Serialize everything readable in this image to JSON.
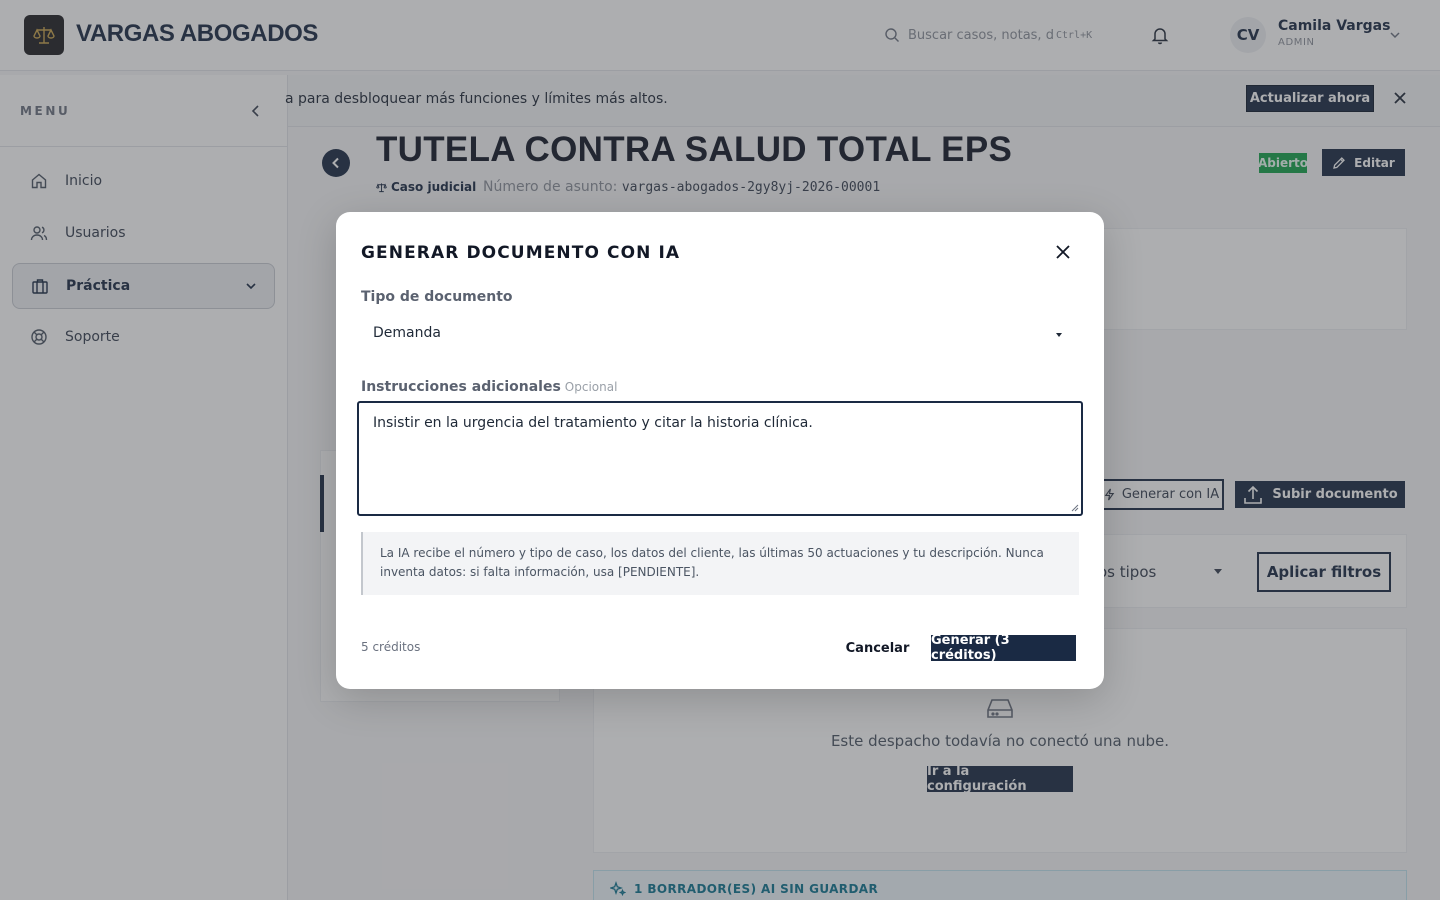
{
  "header": {
    "brand": "VARGAS ABOGADOS",
    "search_placeholder": "Buscar casos, notas, documentos",
    "search_shortcut": "Ctrl+K",
    "user_initials": "CV",
    "user_name": "Camila Vargas",
    "user_role": "ADMIN"
  },
  "sidebar": {
    "title": "MENU",
    "items": [
      {
        "label": "Inicio",
        "icon": "home-icon"
      },
      {
        "label": "Usuarios",
        "icon": "users-icon"
      },
      {
        "label": "Práctica",
        "icon": "briefcase-icon",
        "active": true
      },
      {
        "label": "Soporte",
        "icon": "lifebuoy-icon"
      }
    ]
  },
  "banner": {
    "text": "a para desbloquear más funciones y límites más altos.",
    "upgrade_label": "Actualizar ahora"
  },
  "case": {
    "title": "TUTELA CONTRA SALUD TOTAL EPS",
    "type": "Caso judicial",
    "number_label": "Número de asunto:",
    "number": "vargas-abogados-2gy8yj-2026-00001",
    "status": "Abierto",
    "edit_label": "Editar"
  },
  "documents": {
    "generate_ai_label": "Generar con IA",
    "upload_label": "Subir documento",
    "types_filter": "os tipos",
    "apply_filters_label": "Aplicar filtros",
    "no_cloud_message": "Este despacho todavía no conectó una nube.",
    "config_label": "Ir a la configuración",
    "drafts_notice": "1 BORRADOR(ES) AI SIN GUARDAR"
  },
  "modal": {
    "title": "GENERAR DOCUMENTO CON IA",
    "doc_type_label": "Tipo de documento",
    "doc_type_value": "Demanda",
    "instructions_label": "Instrucciones adicionales",
    "instructions_optional": "Opcional",
    "instructions_value": "Insistir en la urgencia del tratamiento y citar la historia clínica.",
    "info_text": "La IA recibe el número y tipo de caso, los datos del cliente, las últimas 50 actuaciones y tu descripción. Nunca inventa datos: si falta información, usa [PENDIENTE].",
    "credits": "5 créditos",
    "cancel_label": "Cancelar",
    "generate_label": "Generar (3 créditos)"
  },
  "colors": {
    "primary": "#1a2a44",
    "status_open": "#16a34a",
    "overlay": "#3c3e42"
  }
}
